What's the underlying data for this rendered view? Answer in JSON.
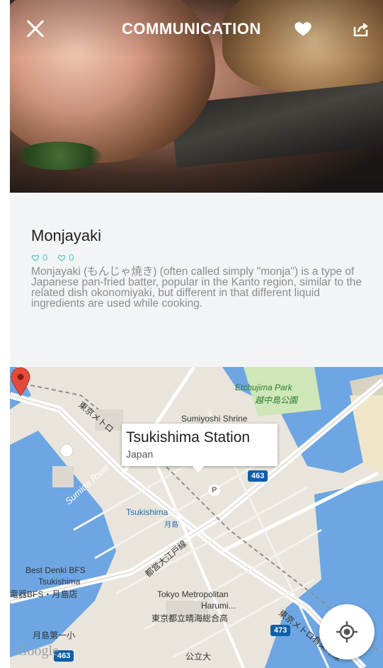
{
  "header": {
    "title": "COMMUNICATION",
    "close_icon": "close-icon",
    "favorite_icon": "heart-icon",
    "share_icon": "share-icon"
  },
  "item": {
    "title": "Monjayaki",
    "likes": "0",
    "comments": "0",
    "description": "Monjayaki (もんじゃ焼き) (often called simply \"monja\") is a type of Japanese pan-fried batter, popular in the Kanto region, similar to the related dish okonomiyaki, but different in that different liquid ingredients are used while cooking."
  },
  "map": {
    "info_title": "Tsukishima Station",
    "info_subtitle": "Japan",
    "labels": {
      "park_en": "Etchujima Park",
      "park_jp": "越中島公園",
      "shrine": "Sumiyoshi Shrine",
      "river": "Sumida River",
      "station_en": "Tsukishima",
      "station_jp": "月島",
      "store_en": "Best Denki BFS",
      "store_en2": "Tsukishima",
      "store_jp": "電器BFS・月島店",
      "metro_top": "東京メトロ",
      "oedo": "都営大江戸線",
      "harumi1": "Tokyo Metropolitan",
      "harumi2": "Harumi...",
      "harumi_jp": "東京都立晴海総合高",
      "school1": "月島第一小",
      "school2": "公立大",
      "metro_bottom": "東京メトロ有楽町線",
      "route_463": "463",
      "route_473": "473",
      "route_463b": "463",
      "parking": "P",
      "google": "Google"
    },
    "locate_icon": "my-location-icon"
  }
}
